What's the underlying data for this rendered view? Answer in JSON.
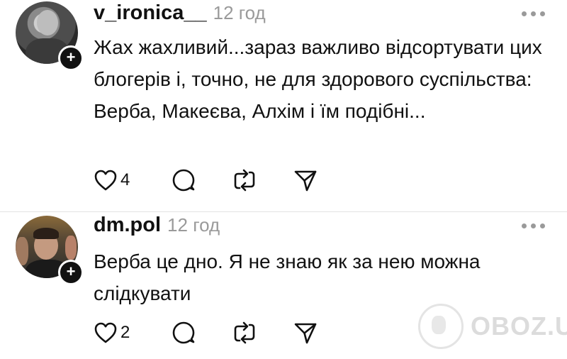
{
  "comments": [
    {
      "username": "v_ironica__",
      "time": "12 год",
      "text": "Жах жахливий...зараз важливо відсортувати цих блогерів і, точно, не для здорового суспільства: Верба, Макеєва, Алхім і їм подібні...",
      "likes": "4"
    },
    {
      "username": "dm.pol",
      "time": "12 год",
      "text": "Верба це дно. Я не знаю як за нею можна слідкувати",
      "likes": "2"
    }
  ],
  "follow_symbol": "+",
  "watermark": "OBOZ.UA",
  "icons": [
    "heart-icon",
    "comment-icon",
    "repost-icon",
    "share-icon",
    "more-icon",
    "plus-icon"
  ],
  "colors": {
    "text": "#111111",
    "muted": "#9a9a9a",
    "divider": "#e3e3e3"
  }
}
